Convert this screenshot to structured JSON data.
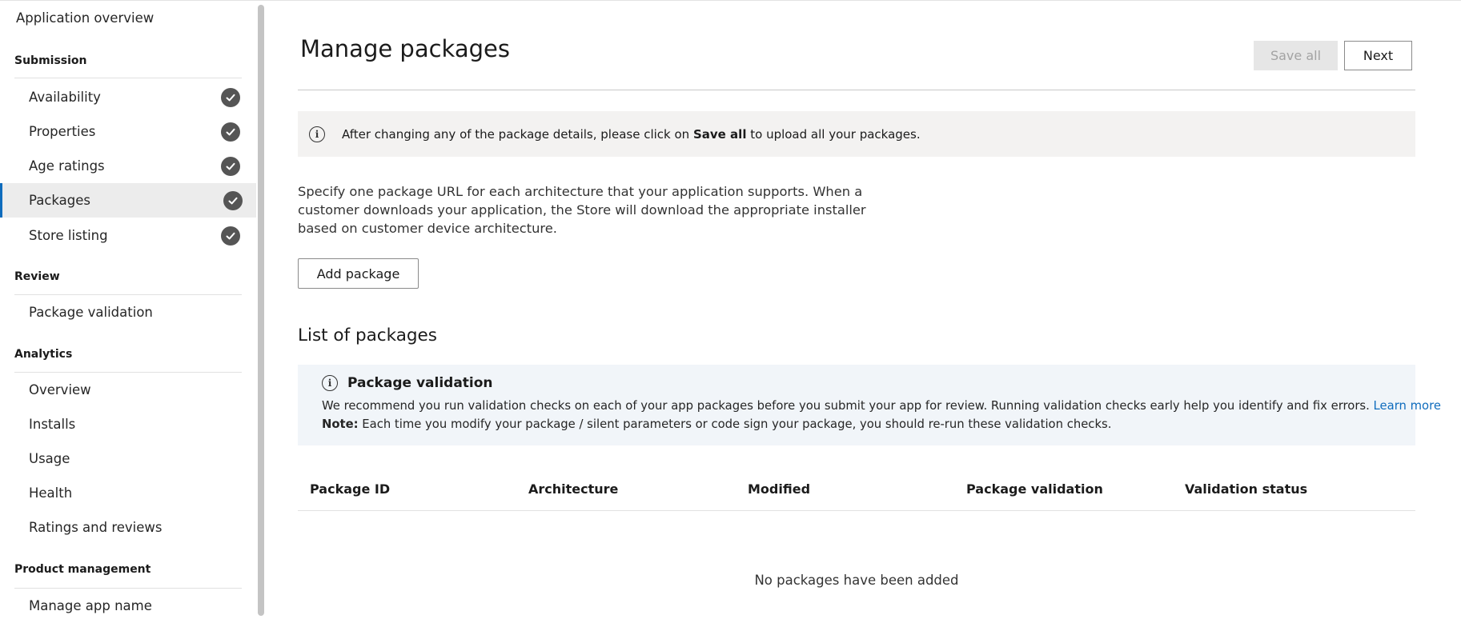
{
  "sidebar": {
    "overview_link": "Application overview",
    "sections": [
      {
        "heading": "Submission",
        "items": [
          {
            "label": "Availability",
            "completed": true,
            "selected": false
          },
          {
            "label": "Properties",
            "completed": true,
            "selected": false
          },
          {
            "label": "Age ratings",
            "completed": true,
            "selected": false
          },
          {
            "label": "Packages",
            "completed": true,
            "selected": true
          },
          {
            "label": "Store listing",
            "completed": true,
            "selected": false
          }
        ]
      },
      {
        "heading": "Review",
        "items": [
          {
            "label": "Package validation"
          }
        ]
      },
      {
        "heading": "Analytics",
        "items": [
          {
            "label": "Overview"
          },
          {
            "label": "Installs"
          },
          {
            "label": "Usage"
          },
          {
            "label": "Health"
          },
          {
            "label": "Ratings and reviews"
          }
        ]
      },
      {
        "heading": "Product management",
        "items": [
          {
            "label": "Manage app name"
          }
        ]
      }
    ]
  },
  "header": {
    "title": "Manage packages",
    "save_all_label": "Save all",
    "next_label": "Next"
  },
  "info_banner": {
    "text_before": "After changing any of the package details, please click on ",
    "bold": "Save all",
    "text_after": " to upload all your packages."
  },
  "description": "Specify one package URL for each architecture that your application supports. When a customer downloads your application, the Store will download the appropriate installer based on customer device architecture.",
  "add_package_label": "Add package",
  "list_title": "List of packages",
  "validation_notice": {
    "title": "Package validation",
    "text": "We recommend you run validation checks on each of your app packages before you submit your app for review. Running validation checks early help you identify and fix errors. ",
    "learn_more": "Learn more",
    "note_label": "Note:",
    "note_text": " Each time you modify your package / silent parameters or code sign your package, you should re-run these validation checks."
  },
  "table": {
    "columns": [
      "Package ID",
      "Architecture",
      "Modified",
      "Package validation",
      "Validation status"
    ],
    "empty_text": "No packages have been added"
  },
  "colors": {
    "accent": "#0f6cbd",
    "check_fill": "#555555",
    "selected_bg": "#ececec",
    "banner_bg": "#f3f2f1",
    "notice_bg": "#f1f5f9"
  }
}
